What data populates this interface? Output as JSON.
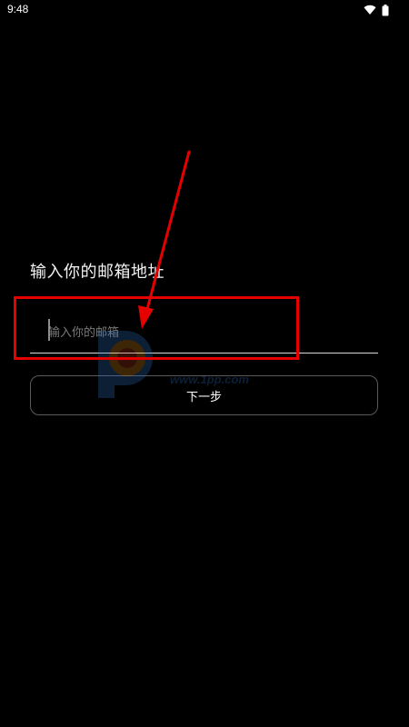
{
  "status_bar": {
    "time": "9:48",
    "icons": [
      "wifi-icon",
      "battery-icon"
    ]
  },
  "heading": "输入你的邮箱地址",
  "email_input": {
    "placeholder": "输入你的邮箱",
    "value": ""
  },
  "next_button": {
    "label": "下一步"
  },
  "annotation": {
    "color": "#e60000"
  },
  "watermark": {
    "text": "",
    "url": "www.1pp.com"
  },
  "colors": {
    "background": "#000000",
    "text": "#ffffff",
    "placeholder": "#7a7a7a",
    "annotation": "#e60000"
  }
}
